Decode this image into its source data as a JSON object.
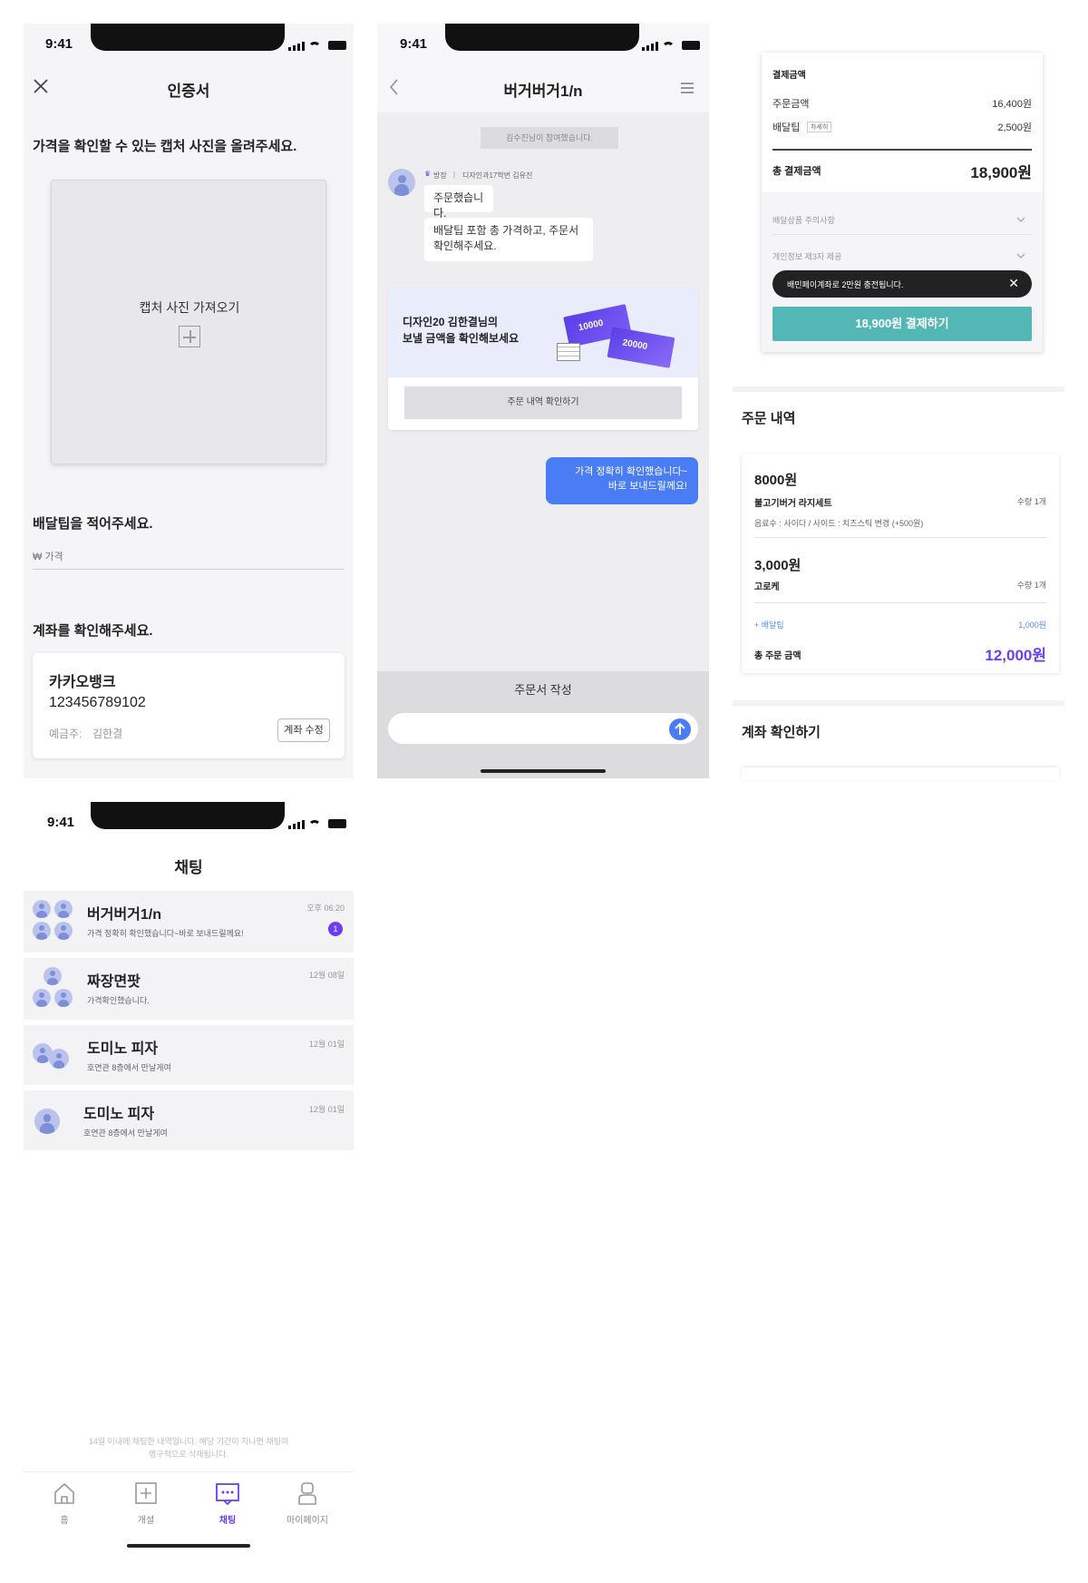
{
  "status": {
    "time": "9:41"
  },
  "screen1": {
    "title": "인증서",
    "instruction": "가격을 확인할 수 있는 캡처 사진을 올려주세요.",
    "upload_label": "캡처 사진 가져오기",
    "tip_label": "배달팁을 적어주세요.",
    "tip_placeholder": "₩ 가격",
    "account_label": "계좌를 확인해주세요.",
    "bank": "카카오뱅크",
    "account_number": "123456789102",
    "holder_label": "예금주:",
    "holder_name": "김한결",
    "edit_button": "계좌 수정"
  },
  "screen2": {
    "title": "버거버거1/n",
    "system_notice": "김수진님이 참여했습니다.",
    "sender_role": "방장",
    "sender_name": "디자인과17학번 김유진",
    "msg1": "주문했습니다.",
    "msg2_line1": "배달팁 포함 총 가격하고, 주문서",
    "msg2_line2": "확인해주세요.",
    "promo_line1": "디자인20 김한결님의",
    "promo_line2": "보낼 금액을 확인해보세요",
    "promo_ticket1": "10000",
    "promo_ticket2": "20000",
    "promo_button": "주문 내역 확인하기",
    "my_msg_line1": "가격 정확히 확인했습니다~",
    "my_msg_line2": "바로 보내드릴께요!",
    "compose_label": "주문서 작성"
  },
  "screen3": {
    "payment_title": "결제금액",
    "order_amount_label": "주문금액",
    "order_amount": "16,400원",
    "delivery_tip_label": "배달팁",
    "delivery_tip_detail": "자세히",
    "delivery_tip": "2,500원",
    "total_label": "총 결제금액",
    "total": "18,900원",
    "accordion1": "배달상품 주의사항",
    "accordion2": "개인정보 제3자 제공",
    "toast": "배민페이계좌로 2만원 충전됩니다.",
    "pay_button": "18,900원 결제하기",
    "order_history_title": "주문 내역",
    "item1_price": "8000원",
    "item1_name": "불고기버거 라지세트",
    "item1_qty": "수량 1개",
    "item1_options": "음료수 : 사이다 / 사이드 : 치즈스틱 변경 (+500원)",
    "item2_price": "3,000원",
    "item2_name": "고로케",
    "item2_qty": "수량 1개",
    "delivery_label": "+ 배달팁",
    "delivery_amount": "1,000원",
    "order_total_label": "총 주문 금액",
    "order_total": "12,000원",
    "account_check_title": "계좌 확인하기"
  },
  "screen4": {
    "title": "채팅",
    "chats": [
      {
        "name": "버거버거1/n",
        "preview": "가격 정확히 확인했습니다~바로 보내드릴께요!",
        "time": "오후 06:20",
        "badge": "1"
      },
      {
        "name": "짜장면팟",
        "preview": "가격확인했습니다.",
        "time": "12월 08일"
      },
      {
        "name": "도미노 피자",
        "preview": "호연관 8층에서 만날게여",
        "time": "12월 01일"
      },
      {
        "name": "도미노 피자",
        "preview": "호연관 8층에서 만날게여",
        "time": "12월 01일"
      }
    ],
    "notice_line1": "14일 이내에 채팅한 내역입니다. 해당 기간이 지나면 채팅이",
    "notice_line2": "영구적으로 삭제됩니다.",
    "tabs": [
      {
        "label": "홈",
        "icon": "home-icon"
      },
      {
        "label": "개설",
        "icon": "add-box-icon"
      },
      {
        "label": "채팅",
        "icon": "chat-icon"
      },
      {
        "label": "마이페이지",
        "icon": "person-icon"
      }
    ]
  },
  "colors": {
    "accent_purple": "#6b3ff0",
    "bubble_blue": "#4a7cf5",
    "pay_teal": "#53b8b5",
    "badge_purple": "#6d3cf5"
  }
}
